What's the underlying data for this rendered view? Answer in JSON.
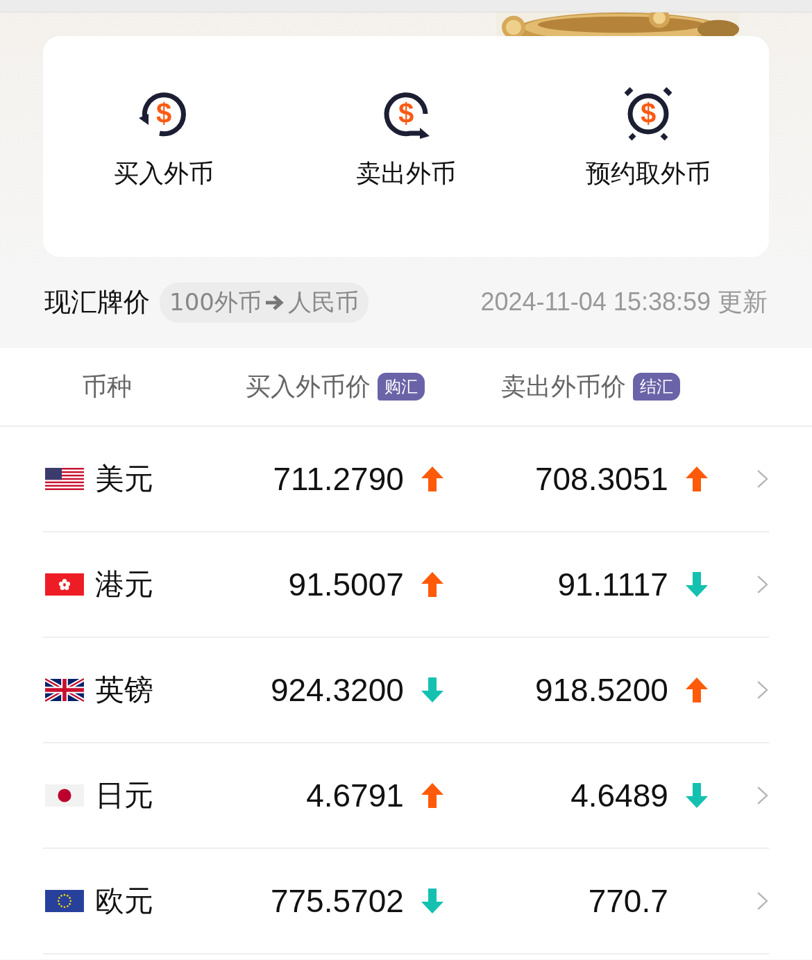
{
  "actions": [
    {
      "label": "买入外币",
      "kind": "buy",
      "symbol": "$"
    },
    {
      "label": "卖出外币",
      "kind": "sell",
      "symbol": "$"
    },
    {
      "label": "预约取外币",
      "kind": "reserve",
      "symbol": "$"
    }
  ],
  "rates_header": {
    "title": "现汇牌价",
    "unit_chip": "100外币",
    "target": "人民币",
    "updated": "2024-11-04 15:38:59",
    "updated_suffix": "更新"
  },
  "table": {
    "columns": [
      {
        "label": "币种"
      },
      {
        "label": "买入外币价",
        "tag": "购汇"
      },
      {
        "label": "卖出外币价",
        "tag": "结汇"
      }
    ],
    "rows": [
      {
        "kind": "us",
        "name": "美元",
        "buy": "711.2790",
        "buy_up": true,
        "sell": "708.3051",
        "sell_up": true
      },
      {
        "kind": "hk",
        "name": "港元",
        "buy": "91.5007",
        "buy_up": true,
        "sell": "91.1117",
        "sell_up": false
      },
      {
        "kind": "gb",
        "name": "英镑",
        "buy": "924.3200",
        "buy_up": false,
        "sell": "918.5200",
        "sell_up": true
      },
      {
        "kind": "jp",
        "name": "日元",
        "buy": "4.6791",
        "buy_up": true,
        "sell": "4.6489",
        "sell_up": false
      },
      {
        "kind": "eu",
        "name": "欧元",
        "buy": "775.5702",
        "buy_up": false,
        "sell": "770.7"
      }
    ]
  }
}
